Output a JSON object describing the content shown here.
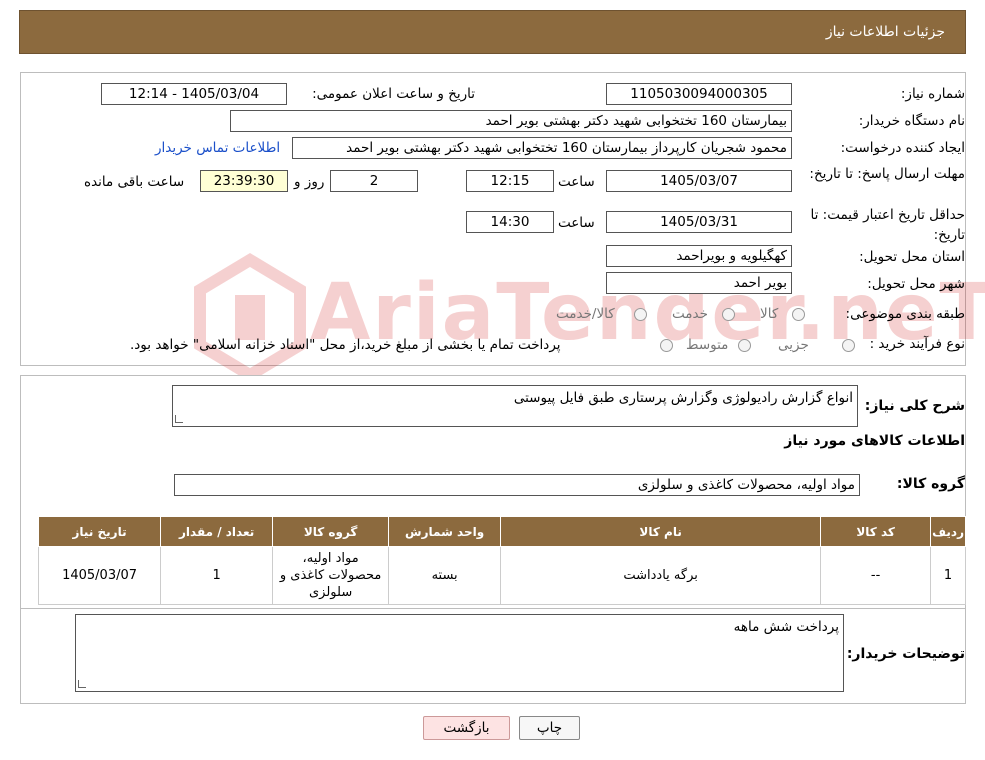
{
  "header": {
    "title": "جزئیات اطلاعات نیاز"
  },
  "need_info": {
    "need_number_label": "شماره نیاز:",
    "need_number": "1105030094000305",
    "announce_label": "تاریخ و ساعت اعلان عمومی:",
    "announce_value": "1405/03/04 - 12:14",
    "buyer_org_label": "نام دستگاه خریدار:",
    "buyer_org": "بیمارستان 160 تختخوابی شهید دکتر بهشتی بویر احمد",
    "requester_label": "ایجاد کننده درخواست:",
    "requester": "محمود شجریان کارپرداز بیمارستان 160 تختخوابی شهید دکتر بهشتی بویر احمد",
    "contact_link": "اطلاعات تماس خریدار",
    "reply_deadline_label": "مهلت ارسال پاسخ: تا تاریخ:",
    "reply_date": "1405/03/07",
    "time_label": "ساعت",
    "reply_time": "12:15",
    "days": "2",
    "days_label": "روز و",
    "remaining": "23:39:30",
    "remaining_label": "ساعت باقی مانده",
    "validity_label": "حداقل تاریخ اعتبار قیمت: تا تاریخ:",
    "validity_date": "1405/03/31",
    "validity_time": "14:30",
    "province_label": "استان محل تحویل:",
    "province": "کهگیلویه و بویراحمد",
    "city_label": "شهر محل تحویل:",
    "city": "بویر احمد",
    "category_label": "طبقه بندی موضوعی:",
    "category_options": [
      "کالا",
      "خدمت",
      "کالا/خدمت"
    ],
    "process_label": "نوع فرآیند خرید :",
    "process_options": [
      "جزیی",
      "متوسط"
    ],
    "process_note": "پرداخت تمام یا بخشی از مبلغ خرید،از محل \"اسناد خزانه اسلامی\" خواهد بود."
  },
  "description": {
    "label": "شرح کلی نیاز:",
    "value": "انواع گزارش رادیولوژی وگزارش پرستاری طبق فایل پیوستی",
    "goods_title": "اطلاعات کالاهای مورد نیاز",
    "group_label": "گروه کالا:",
    "group_value": "مواد اولیه، محصولات کاغذی و سلولزی"
  },
  "table": {
    "headers": [
      "ردیف",
      "کد کالا",
      "نام کالا",
      "واحد شمارش",
      "گروه کالا",
      "تعداد / مقدار",
      "تاریخ نیاز"
    ],
    "rows": [
      [
        "1",
        "--",
        "برگه یادداشت",
        "بسته",
        "مواد اولیه، محصولات کاغذی و سلولزی",
        "1",
        "1405/03/07"
      ]
    ]
  },
  "buyer_notes": {
    "label": "توضیحات خریدار:",
    "value": "پرداخت شش ماهه"
  },
  "buttons": {
    "print": "چاپ",
    "back": "بازگشت"
  },
  "watermark": {
    "text": "AriaTender.neT"
  }
}
